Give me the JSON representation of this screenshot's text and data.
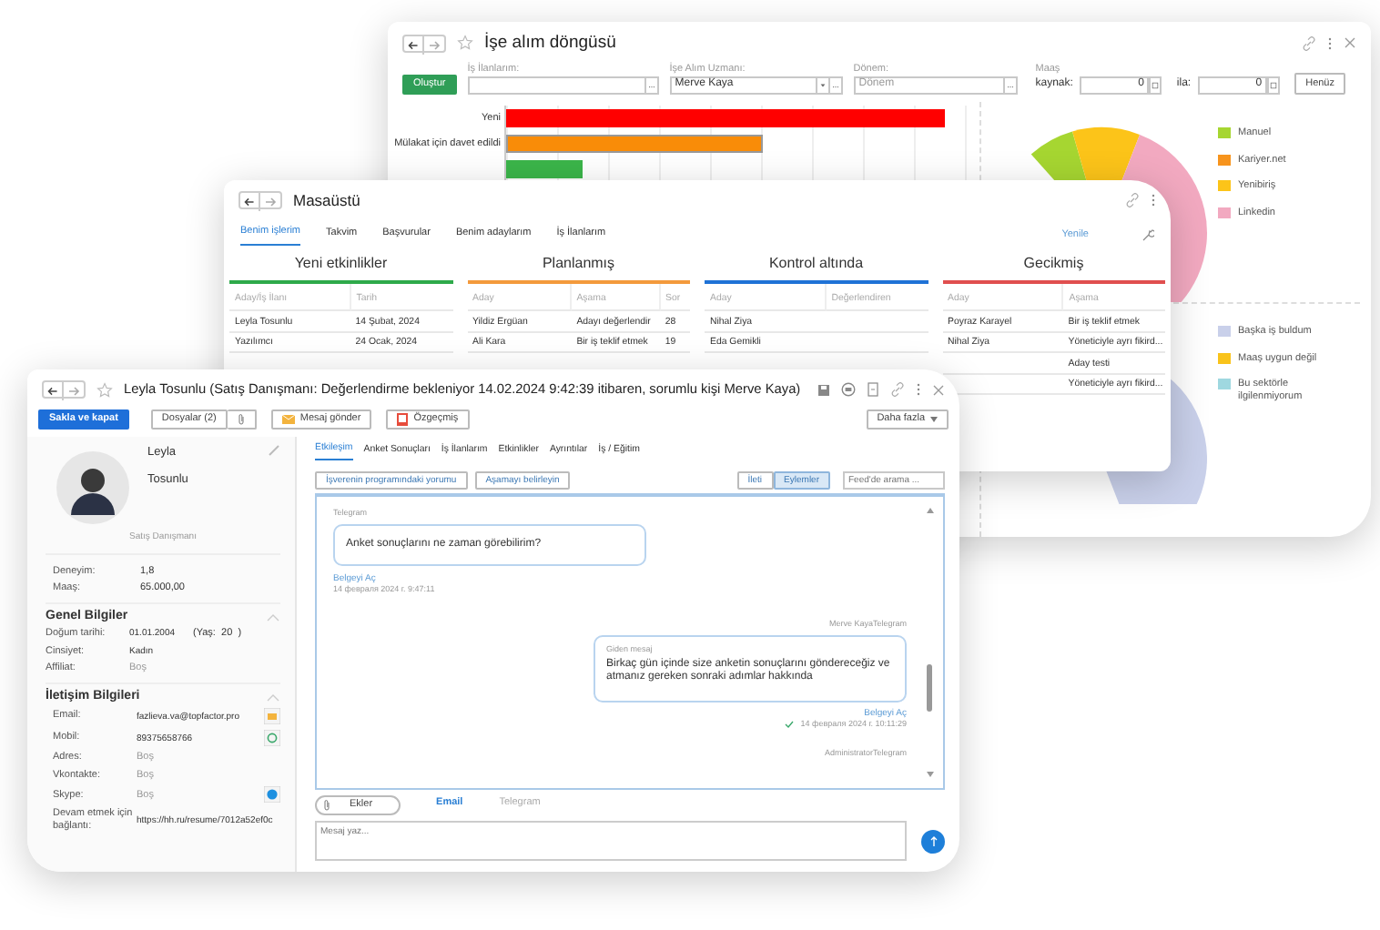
{
  "recruiting_window": {
    "title": "İşe alım döngüsü",
    "create_button": "Oluştur",
    "filters": [
      {
        "label": "İş İlanlarım:"
      },
      {
        "label": "İşe Alım Uzmanı:",
        "value": "Merve Kaya"
      },
      {
        "label": "Dönem:",
        "placeholder": "Dönem"
      }
    ],
    "salary": {
      "label": "Maaş",
      "from_label": "kaynak:",
      "from_value": "0",
      "to_label": "ila:",
      "to_value": "0"
    },
    "apply_button": "Henüz",
    "bar_labels": [
      "Yeni",
      "Mülakat için davet edildi"
    ],
    "source_legend": [
      {
        "label": "Manuel",
        "color": "#a6d631"
      },
      {
        "label": "Kariyer.net",
        "color": "#f7941d"
      },
      {
        "label": "Yenibiriş",
        "color": "#fcc419"
      },
      {
        "label": "Linkedin",
        "color": "#f2a9c0"
      }
    ],
    "reason_legend": [
      {
        "label": "Başka iş buldum",
        "color": "#c9d0ea"
      },
      {
        "label": "Maaş uygun değil",
        "color": "#f9c31b"
      },
      {
        "label": "Bu sektörle ilgilenmiyorum",
        "color": "#9fd8e0"
      }
    ]
  },
  "desktop_window": {
    "title": "Masaüstü",
    "tabs": [
      {
        "label": "Benim işlerim",
        "selected": true
      },
      {
        "label": "Takvim",
        "selected": false
      },
      {
        "label": "Başvurular",
        "selected": false
      },
      {
        "label": "Benim adaylarım",
        "selected": false
      },
      {
        "label": "İş İlanlarım",
        "selected": false
      }
    ],
    "refresh_link": "Yenile",
    "boards": [
      {
        "title": "Yeni etkinlikler",
        "color": "#2eaa4a",
        "columns": [
          "Aday/İş İlanı",
          "Tarih"
        ],
        "rows": [
          [
            "Leyla Tosunlu",
            "14 Şubat, 2024"
          ],
          [
            "Yazılımcı",
            "24 Ocak, 2024"
          ]
        ]
      },
      {
        "title": "Planlanmış",
        "color": "#f39a3c",
        "columns": [
          "Aday",
          "Aşama",
          "Sor"
        ],
        "rows": [
          [
            "Yildiz Ergüan",
            "Adayı değerlendir",
            "28"
          ],
          [
            "Ali Kara",
            "Bir iş teklif etmek",
            "19"
          ]
        ]
      },
      {
        "title": "Kontrol altında",
        "color": "#1f72d6",
        "columns": [
          "Aday",
          "Değerlendiren"
        ],
        "rows": [
          [
            "Nihal Ziya"
          ],
          [
            "Eda Gemikli"
          ]
        ]
      },
      {
        "title": "Gecikmiş",
        "color": "#e04f4f",
        "columns": [
          "Aday",
          "Aşama"
        ],
        "rows": [
          [
            "Poyraz Karayel",
            "Bir iş teklif etmek"
          ],
          [
            "Nihal Ziya",
            "Yöneticiyle ayrı fikird..."
          ],
          [
            null,
            "Aday testi"
          ],
          [
            null,
            "Yöneticiyle ayrı fikird..."
          ]
        ]
      }
    ]
  },
  "candidate_window": {
    "title": "Leyla Tosunlu (Satış Danışmanı: Değerlendirme bekleniyor 14.02.2024 9:42:39 itibaren, sorumlu kişi Merve Kaya)",
    "toolbar": {
      "save_close": "Sakla ve kapat",
      "files": "Dosyalar (2)",
      "send_message": "Mesaj gönder",
      "resume": "Özgeçmiş",
      "more": "Daha fazla"
    },
    "profile": {
      "first_name": "Leyla",
      "last_name": "Tosunlu",
      "position": "Satış Danışmanı",
      "stats": [
        {
          "label": "Deneyim:",
          "value": "1,8"
        },
        {
          "label": "Maaş:",
          "value": "65.000,00"
        }
      ]
    },
    "sections": [
      {
        "title": "Genel Bilgiler",
        "expanded": true,
        "fields": [
          {
            "label": "Doğum tarihi:",
            "value": "01.01.2004",
            "extra": "(Yaş:  20  )",
            "empty": false
          },
          {
            "label": "Cinsiyet:",
            "value": "Kadın",
            "empty": false
          },
          {
            "label": "Affiliat:",
            "value": "Boş",
            "empty": true
          }
        ]
      },
      {
        "title": "İletişim Bilgileri",
        "expanded": true,
        "fields": [
          {
            "kind": "email",
            "label": "Email:",
            "value": "fazlieva.va@topfactor.pro",
            "empty": false
          },
          {
            "kind": "phone",
            "label": "Mobil:",
            "value": "89375658766",
            "empty": false
          },
          {
            "kind": "text",
            "label": "Adres:",
            "value": "Boş",
            "empty": true
          },
          {
            "kind": "text",
            "label": "Vkontakte:",
            "value": "Boş",
            "empty": true
          },
          {
            "kind": "skype",
            "label": "Skype:",
            "value": "Boş",
            "empty": true
          },
          {
            "kind": "text",
            "label": "Devam etmek için bağlantı:",
            "value": "https://hh.ru/resume/7012a52ef0c",
            "empty": false
          }
        ]
      }
    ],
    "tabs": [
      {
        "label": "Etkileşim",
        "selected": true
      },
      {
        "label": "Anket Sonuçları",
        "selected": false
      },
      {
        "label": "İş İlanlarım",
        "selected": false
      },
      {
        "label": "Etkinlikler",
        "selected": false
      },
      {
        "label": "Ayrıntılar",
        "selected": false
      },
      {
        "label": "İş / Eğitim",
        "selected": false
      }
    ],
    "actions": [
      "İşverenin programındaki yorumu",
      "Aşamayı belirleyin"
    ],
    "feed_filter": [
      {
        "label": "İleti",
        "selected": false
      },
      {
        "label": "Eylemler",
        "selected": true
      }
    ],
    "feed_search": {
      "placeholder": "Feed'de arama ..."
    },
    "feed": [
      {
        "kind": "incoming",
        "channel": "Telegram",
        "text": "Anket sonuçlarını ne zaman görebilirim?",
        "link": "Belgeyi Aç",
        "time": "14 февраля 2024 г. 9:47:11"
      },
      {
        "kind": "outgoing",
        "channel": "Merve KayaTelegram",
        "subtitle": "Giden mesaj",
        "text": "Birkaç gün içinde size anketin sonuçlarını göndereceğiz ve atmanız gereken sonraki adımlar hakkında",
        "link": "Belgeyi Aç",
        "time": "14 февраля 2024 г. 10:11:29",
        "delivered": true
      },
      {
        "kind": "label",
        "channel": "AdministratorTelegram"
      }
    ],
    "composer": {
      "attach": "Ekler",
      "channels": [
        {
          "label": "Email",
          "selected": true
        },
        {
          "label": "Telegram",
          "selected": false
        }
      ],
      "placeholder": "Mesaj yaz..."
    }
  }
}
